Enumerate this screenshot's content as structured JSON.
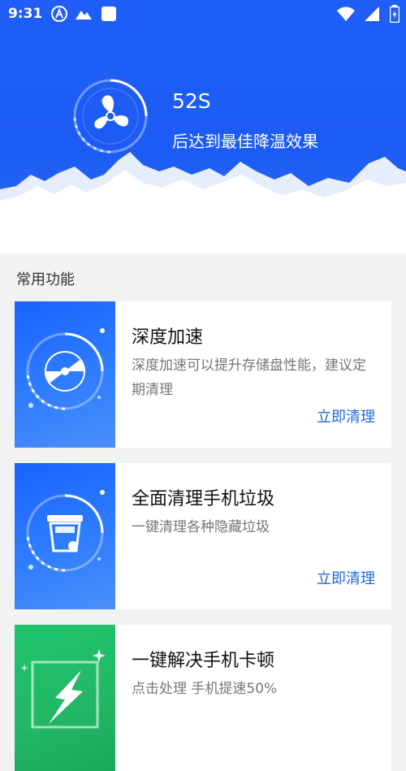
{
  "status_bar": {
    "time": "9:31",
    "icons": [
      "a-circle-icon",
      "mountain-icon",
      "square-icon",
      "wifi-icon",
      "signal-icon",
      "battery-icon"
    ]
  },
  "hero": {
    "countdown": "52S",
    "subtitle": "后达到最佳降温效果",
    "icon": "fan-icon"
  },
  "section": {
    "title": "常用功能"
  },
  "cards": [
    {
      "title": "深度加速",
      "desc": "深度加速可以提升存储盘性能，建议定期清理",
      "action": "立即清理",
      "icon": "disc-icon",
      "thumb_color": "#2a74ff"
    },
    {
      "title": "全面清理手机垃圾",
      "desc": "一键清理各种隐藏垃圾",
      "action": "立即清理",
      "icon": "trash-icon",
      "thumb_color": "#2a74ff"
    },
    {
      "title": "一键解决手机卡顿",
      "desc": "点击处理 手机提速50%",
      "icon": "lightning-icon",
      "thumb_color": "#22bb66"
    }
  ]
}
